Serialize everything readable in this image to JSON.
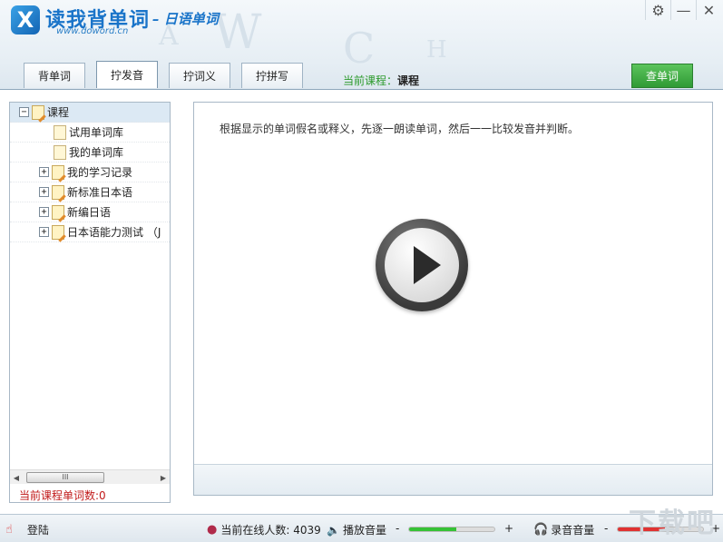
{
  "app": {
    "title": "读我背单词",
    "subtitle": "– 日语单词",
    "url": "www.doword.cn",
    "logo_glyph": "X"
  },
  "window_controls": {
    "settings_glyph": "⚙",
    "minimize_glyph": "—",
    "close_glyph": "✕"
  },
  "tabs": [
    {
      "label": "背单词"
    },
    {
      "label": "拧发音"
    },
    {
      "label": "拧词义"
    },
    {
      "label": "拧拼写"
    }
  ],
  "course": {
    "key": "当前课程：",
    "value": "课程"
  },
  "lookup_button": "查单词",
  "tree": {
    "root": "课程",
    "items": [
      {
        "label": "试用单词库"
      },
      {
        "label": "我的单词库"
      },
      {
        "label": "我的学习记录"
      },
      {
        "label": "新标准日本语"
      },
      {
        "label": "新编日语"
      },
      {
        "label": "日本语能力测试 （J"
      }
    ],
    "expand_minus": "−",
    "expand_plus": "+",
    "scroll_grip": "III"
  },
  "word_count_label": "当前课程单词数:0",
  "instruction": "根据显示的单词假名或释义，先逐一朗读单词，然后一一比较发音并判断。",
  "status": {
    "login": "登陆",
    "online_label": "当前在线人数: 4039",
    "playback_label": "播放音量",
    "record_label": "录音音量",
    "minus": "-",
    "plus": "+",
    "playback_volume": 0.55,
    "record_volume": 0.55,
    "playback_color": "#35c235",
    "record_color": "#e03232"
  },
  "watermark": "下载吧"
}
